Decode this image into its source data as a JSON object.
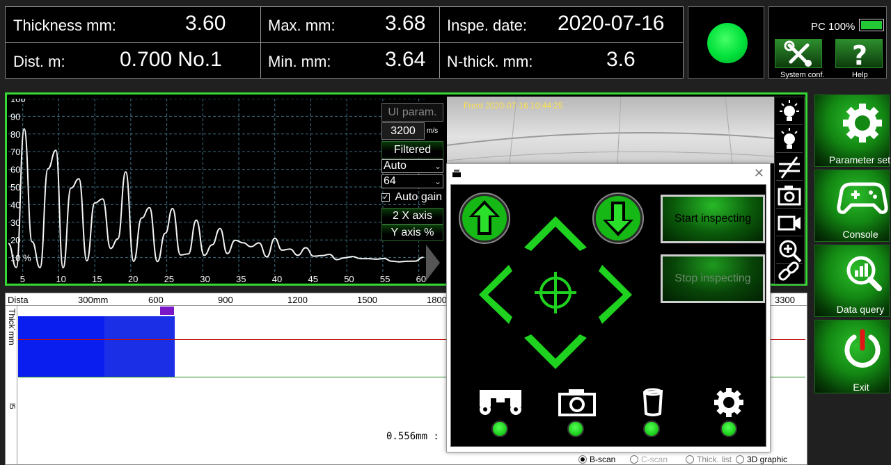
{
  "readout": {
    "thickness_label": "Thickness mm:",
    "thickness_value": "3.60",
    "max_label": "Max. mm:",
    "max_value": "3.68",
    "date_label": "Inspe. date:",
    "date_value": "2020-07-16",
    "dist_label": "Dist. m:",
    "dist_value": "0.700 No.1",
    "min_label": "Min. mm:",
    "min_value": "3.64",
    "nthick_label": "N-thick. mm:",
    "nthick_value": "3.6"
  },
  "status": {
    "lamp_color": "#00e03a",
    "pc_label": "PC 100%",
    "battery_percent": 100
  },
  "system": {
    "system_conf_label": "System conf.",
    "help_label": "Help"
  },
  "waveform": {
    "controls": {
      "ui_param_label": "UI param.",
      "velocity_value": "3200",
      "velocity_unit": "m/s",
      "filtered_label": "Filtered",
      "gain_mode": "Auto",
      "gain_value": "64",
      "auto_gain_label": "Auto gain",
      "auto_gain_checked": true,
      "x_axis_label": "2 X axis",
      "y_axis_label": "Y axis %"
    },
    "y_ticks": [
      "100",
      "90",
      "80",
      "70",
      "60",
      "50",
      "40",
      "30",
      "20",
      "10 %"
    ],
    "x_ticks": [
      "5",
      "10",
      "15",
      "20",
      "25",
      "30",
      "35",
      "40",
      "45",
      "50",
      "55",
      "60"
    ]
  },
  "chart_data": {
    "type": "line",
    "xlabel": "",
    "ylabel": "",
    "xlim": [
      3,
      61
    ],
    "ylim": [
      0,
      100
    ],
    "grid": true,
    "x": [
      3.0,
      4.1,
      5.2,
      6.3,
      7.4,
      8.5,
      9.6,
      10.6,
      11.7,
      12.8,
      13.9,
      15.0,
      16.1,
      17.2,
      18.2,
      19.3,
      20.4,
      21.5,
      22.6,
      23.7,
      24.8,
      25.8,
      26.9,
      28.0,
      29.1,
      30.2,
      31.3,
      32.4,
      33.4,
      34.5,
      35.6,
      36.7,
      37.8,
      38.9,
      40.0,
      41.0,
      42.1,
      43.2,
      44.3,
      45.4,
      46.5,
      47.6,
      48.6,
      49.7,
      50.8,
      51.9,
      53.0,
      54.1,
      55.2,
      56.2,
      57.3,
      58.4,
      59.5,
      60.6
    ],
    "y": [
      18.0,
      4.4,
      82.9,
      19.0,
      4.3,
      60.3,
      70.8,
      4.2,
      49.4,
      54.6,
      8.2,
      40.9,
      43.2,
      15.2,
      20.6,
      58.6,
      7.9,
      32.4,
      38.3,
      7.8,
      23.8,
      37.8,
      11.5,
      12.1,
      31.2,
      11.3,
      17.2,
      26.5,
      12.3,
      19.8,
      18.4,
      16.2,
      18.3,
      10.4,
      20.9,
      14.2,
      14.8,
      11.3,
      15.6,
      10.8,
      11.1,
      11.8,
      8.8,
      9.9,
      10.6,
      9.4,
      9.4,
      9.1,
      9.5,
      8.0,
      7.6,
      7.9,
      8.0,
      10.2
    ]
  },
  "camera": {
    "timestamp": "Front 2020-07-16 10:44:25"
  },
  "side_tools": [
    "light-on-icon",
    "light-icon",
    "sort-icon",
    "camera-icon",
    "video-icon",
    "zoom-in-icon",
    "link-icon"
  ],
  "nav": {
    "parameter_set_label": "Parameter set",
    "console_label": "Console",
    "data_query_label": "Data query",
    "exit_label": "Exit"
  },
  "bscan": {
    "x_label": "Dista",
    "y_label": "Thick´mm",
    "y_tick": "l5",
    "ruler_ticks": [
      "300mm",
      "600",
      "900",
      "1200",
      "1500",
      "1800",
      "3300"
    ],
    "readout_text": "0.556mm :",
    "modes": [
      "B-scan",
      "C-scan",
      "Thick. list",
      "3D graphic"
    ],
    "selected_mode": "B-scan"
  },
  "dialog": {
    "start_label": "Start inspecting",
    "stop_label": "Stop inspecting",
    "status_dots": [
      "#1fd21f",
      "#1fd21f",
      "#1fd21f",
      "#1fd21f"
    ]
  }
}
